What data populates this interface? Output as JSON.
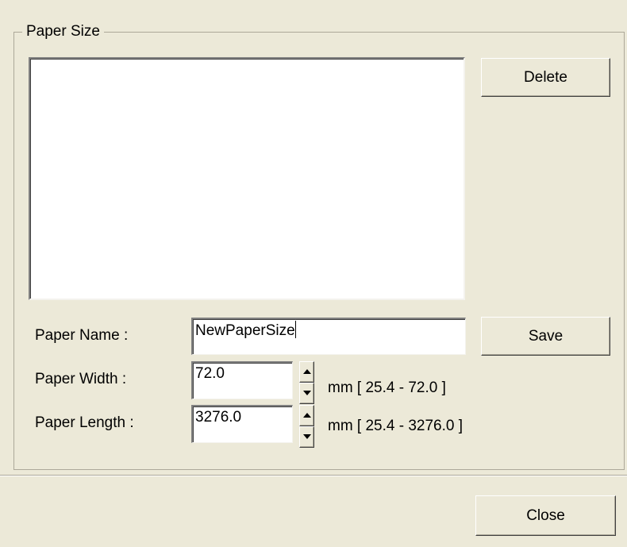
{
  "group": {
    "title": "Paper Size"
  },
  "list": {
    "items": []
  },
  "buttons": {
    "delete": "Delete",
    "save": "Save",
    "close": "Close"
  },
  "fields": {
    "name": {
      "label": "Paper Name :",
      "value": "NewPaperSize"
    },
    "width": {
      "label": "Paper Width :",
      "value": "72.0",
      "range": "mm [ 25.4 - 72.0 ]"
    },
    "length": {
      "label": "Paper Length :",
      "value": "3276.0",
      "range": "mm [ 25.4 - 3276.0 ]"
    }
  },
  "icons": {
    "spin_up": "spin-up-arrow-icon",
    "spin_down": "spin-down-arrow-icon"
  }
}
